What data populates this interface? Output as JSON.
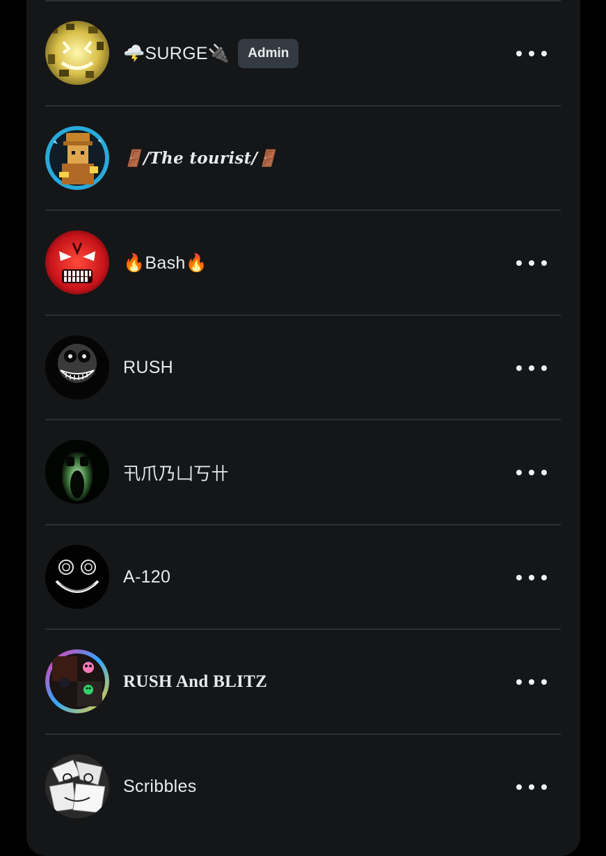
{
  "members": [
    {
      "name": "🌩️SURGE🔌",
      "badge": "Admin",
      "avatar_icon": "glowing-yellow-face-avatar",
      "has_menu": true,
      "name_style": "sans"
    },
    {
      "name": "🚪/The tourist/🚪",
      "badge": "",
      "avatar_icon": "roblox-character-avatar",
      "has_menu": false,
      "name_style": "serif-italic"
    },
    {
      "name": "🔥Bash🔥",
      "badge": "",
      "avatar_icon": "red-angry-face-avatar",
      "has_menu": true,
      "name_style": "sans"
    },
    {
      "name": "RUSH",
      "badge": "",
      "avatar_icon": "rush-grin-face-avatar",
      "has_menu": true,
      "name_style": "sans"
    },
    {
      "name": "卂爪乃凵丂卄",
      "badge": "",
      "avatar_icon": "green-screaming-face-avatar",
      "has_menu": true,
      "name_style": "sans"
    },
    {
      "name": "A-120",
      "badge": "",
      "avatar_icon": "smiling-dark-face-avatar",
      "has_menu": true,
      "name_style": "sans"
    },
    {
      "name": "RUSH And BLITZ",
      "badge": "",
      "avatar_icon": "rush-and-blitz-avatar",
      "has_menu": true,
      "name_style": "serif-bold"
    },
    {
      "name": "Scribbles",
      "badge": "",
      "avatar_icon": "scribbles-paper-face-avatar",
      "has_menu": true,
      "name_style": "sans"
    }
  ],
  "colors": {
    "panel_bg": "#151618",
    "divider": "#2c2f33",
    "text": "#e9eaec",
    "badge_bg": "#333a42"
  }
}
